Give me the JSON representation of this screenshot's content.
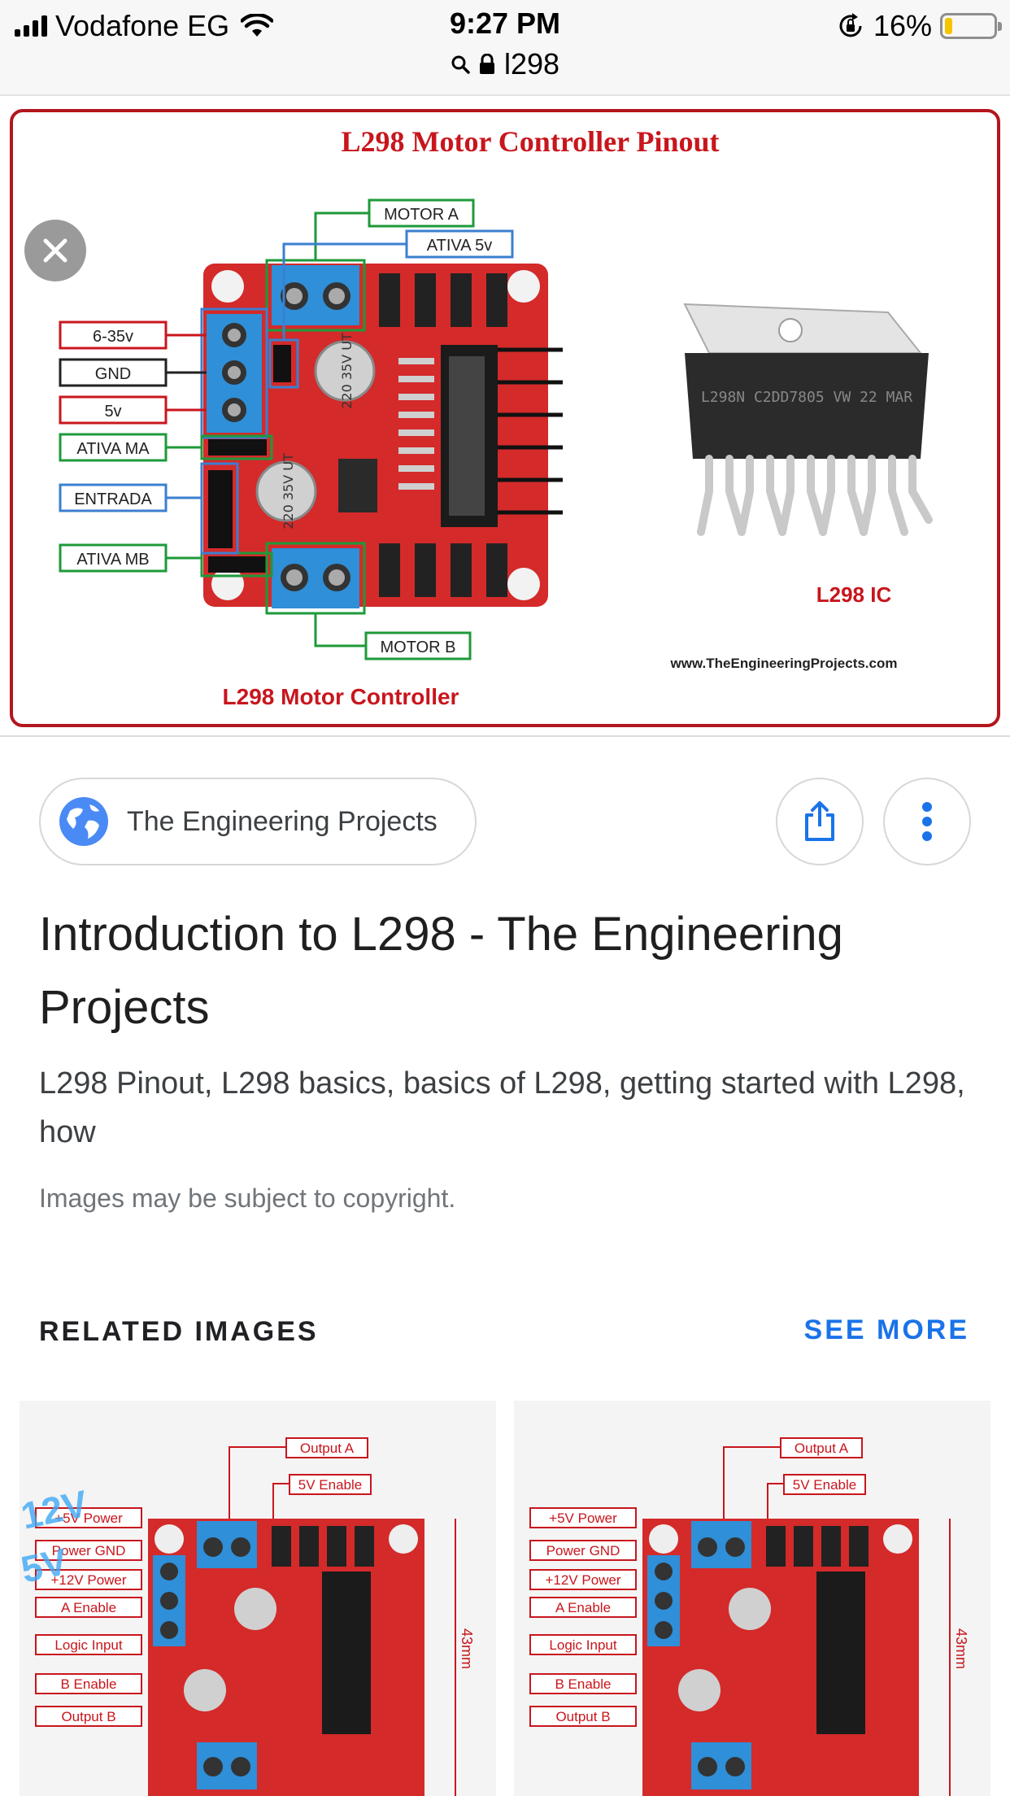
{
  "status_bar": {
    "carrier": "Vodafone EG",
    "time": "9:27 PM",
    "url": "l298",
    "battery_percent": "16%",
    "battery_level": 0.16,
    "icons": [
      "signal-icon",
      "wifi-icon",
      "search-icon",
      "lock-icon",
      "rotation-lock-icon",
      "battery-icon"
    ]
  },
  "viewer": {
    "figure": {
      "title": "L298 Motor Controller Pinout",
      "labels_left": [
        "6-35v",
        "GND",
        "5v",
        "ATIVA MA",
        "ENTRADA",
        "ATIVA MB"
      ],
      "label_motor_a": "MOTOR A",
      "label_ativa_5v": "ATIVA 5v",
      "label_motor_b": "MOTOR B",
      "caption_board": "L298 Motor Controller",
      "caption_ic": "L298 IC",
      "website": "www.TheEngineeringProjects.com",
      "cap1_text": "220 35V UT",
      "cap2_text": "220 35V UT",
      "chip_marking": "L298N C2DD7805 VW 22 MAR"
    }
  },
  "source": {
    "name": "The Engineering Projects",
    "icon": "globe-icon"
  },
  "result": {
    "title": "Introduction to L298 - The Engineering Projects",
    "description": "L298 Pinout, L298 basics, basics of L298, getting started with L298, how",
    "copyright": "Images may be subject to copyright."
  },
  "related": {
    "heading": "RELATED IMAGES",
    "see_more": "SEE MORE",
    "thumb1": {
      "labels_top": [
        "Output A",
        "5V Enable"
      ],
      "labels_left": [
        "+5V Power",
        "Power GND",
        "+12V Power",
        "A Enable",
        "Logic Input",
        "B Enable",
        "Output B"
      ],
      "side_label": "43mm",
      "overlay_1": "12V",
      "overlay_2": "5V"
    },
    "thumb2": {
      "labels_top": [
        "Output A",
        "5V Enable"
      ],
      "labels_left": [
        "+5V Power",
        "Power GND",
        "+12V Power",
        "A Enable",
        "Logic Input",
        "B Enable",
        "Output B"
      ],
      "side_label": "43mm"
    }
  },
  "colors": {
    "accent_blue": "#1a73e8",
    "board_red": "#d32626",
    "label_red": "#c8161d",
    "label_green": "#1e9a3a",
    "label_blue": "#3b7fd0",
    "terminal_blue": "#2f8fd8"
  }
}
